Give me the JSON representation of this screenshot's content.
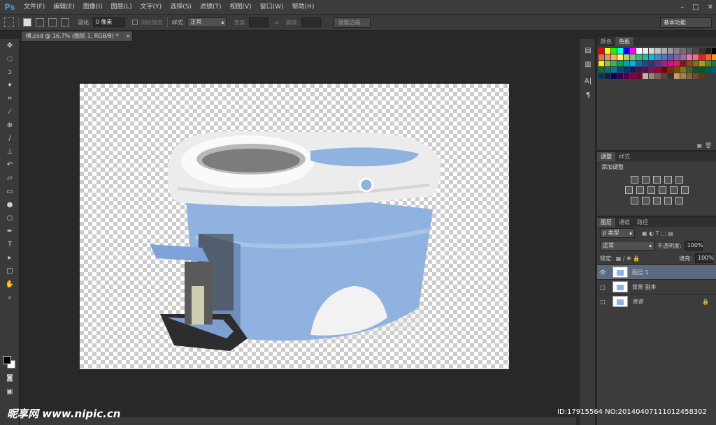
{
  "app": {
    "logo": "Ps"
  },
  "menu": [
    "文件(F)",
    "编辑(E)",
    "图像(I)",
    "图层(L)",
    "文字(Y)",
    "选择(S)",
    "滤镜(T)",
    "视图(V)",
    "窗口(W)",
    "帮助(H)"
  ],
  "window_controls": [
    "–",
    "□",
    "✕"
  ],
  "options": {
    "feather_label": "羽化:",
    "feather_value": "0 像素",
    "antialias_label": "消除锯齿",
    "style_label": "样式:",
    "style_value": "正常",
    "width_label": "宽度:",
    "height_label": "高度:",
    "refine_button": "调整边缘...",
    "workspace": "基本功能"
  },
  "document": {
    "tab": "桶.psd @ 16.7% (图层 1, RGB/8) *",
    "close": "×"
  },
  "panels": {
    "color_tabs": [
      "颜色",
      "色板"
    ],
    "adjust_tabs": [
      "调整",
      "样式"
    ],
    "adjust_title": "添加调整",
    "layers_tabs": [
      "图层",
      "通道",
      "路径"
    ],
    "filter_kind": "ρ 类型",
    "blend_mode": "正常",
    "opacity_label": "不透明度:",
    "opacity_value": "100%",
    "lock_label": "锁定:",
    "fill_label": "填充:",
    "fill_value": "100%"
  },
  "layers": [
    {
      "name": "图层 1",
      "visible": true,
      "selected": true
    },
    {
      "name": "背景 副本",
      "visible": false,
      "selected": false
    },
    {
      "name": "背景",
      "visible": false,
      "selected": false,
      "locked": true
    }
  ],
  "watermark": {
    "brand": "昵享网 www.nipic.cn",
    "id": "ID:17915564 NO:20140407111012458302"
  },
  "swatch_colors": [
    "#ff0000",
    "#ffff00",
    "#00ff00",
    "#00ffff",
    "#0000ff",
    "#ff00ff",
    "#ffffff",
    "#ebebeb",
    "#d6d6d6",
    "#c2c2c2",
    "#adadad",
    "#999999",
    "#858585",
    "#707070",
    "#5c5c5c",
    "#474747",
    "#333333",
    "#1f1f1f",
    "#000000",
    "#f26c4f",
    "#f68e56",
    "#fbaf5c",
    "#fff467",
    "#acd372",
    "#7dc473",
    "#3cb878",
    "#1abbb4",
    "#00bff3",
    "#438ccb",
    "#5574b9",
    "#605ca8",
    "#855fa8",
    "#a763a9",
    "#f06ea9",
    "#f16d7e",
    "#ed1c24",
    "#f26522",
    "#f7941d",
    "#fff200",
    "#8dc63f",
    "#39b54a",
    "#00a651",
    "#00a99d",
    "#00aeef",
    "#0072bc",
    "#0054a6",
    "#2e3192",
    "#662d91",
    "#92278f",
    "#ec008c",
    "#ed145b",
    "#9e0b0f",
    "#a0410d",
    "#a3620a",
    "#aba000",
    "#598527",
    "#197b30",
    "#007236",
    "#00746b",
    "#0076a3",
    "#004a80",
    "#003471",
    "#1b1464",
    "#440e62",
    "#630460",
    "#9e005d",
    "#9e0039",
    "#790000",
    "#7b2e00",
    "#7d4900",
    "#827b00",
    "#406618",
    "#005e20",
    "#005826",
    "#005952",
    "#005b7f",
    "#003663",
    "#002157",
    "#0d004c",
    "#32004b",
    "#4b0049",
    "#7b0046",
    "#7a0026",
    "#c7b299",
    "#998675",
    "#736357",
    "#534741",
    "#37302a",
    "#c69c6d",
    "#a67c52",
    "#8c6239",
    "#754c24",
    "#603913"
  ]
}
